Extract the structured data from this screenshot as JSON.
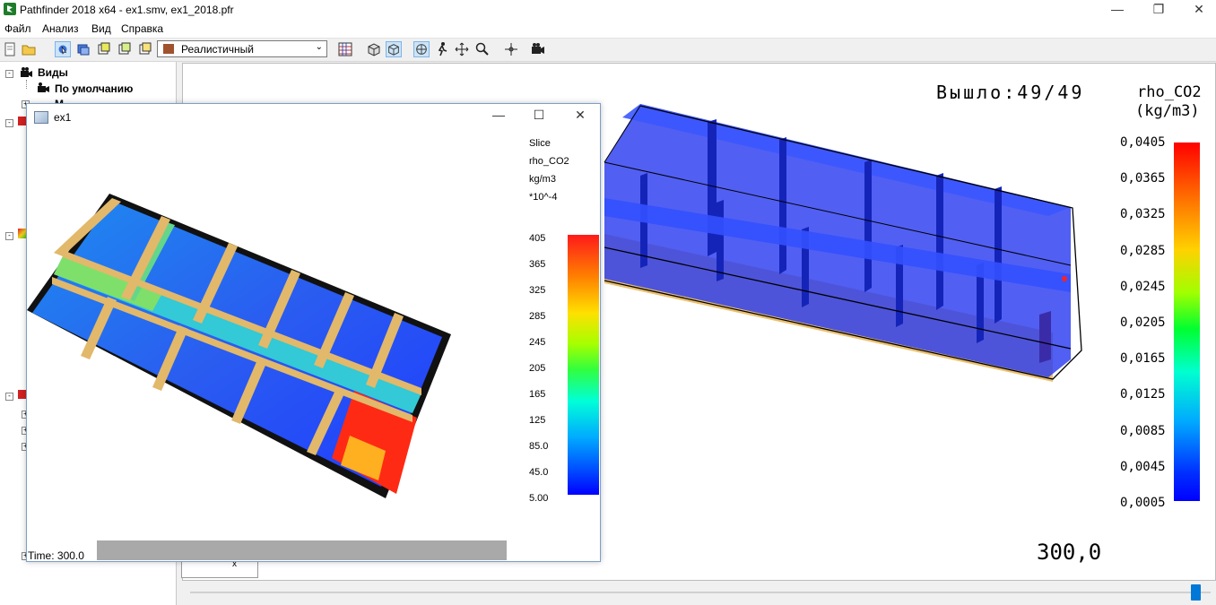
{
  "window": {
    "title": "Pathfinder 2018 x64 - ex1.smv, ex1_2018.pfr"
  },
  "window_controls": {
    "minimize": "—",
    "maximize": "❐",
    "close": "✕"
  },
  "menu": {
    "items": [
      "Файл",
      "Анализ",
      "Вид",
      "Справка"
    ]
  },
  "toolbar": {
    "render_mode": "Реалистичный"
  },
  "tree": {
    "root_label": "Виды",
    "child_label": "По умолчанию",
    "partial_label": "М"
  },
  "viewport": {
    "exited_label": "Вышло:49/49",
    "colorbar_title_1": "rho_CO2",
    "colorbar_title_2": "(kg/m3)",
    "colorbar_ticks": [
      "0,0405",
      "0,0365",
      "0,0325",
      "0,0285",
      "0,0245",
      "0,0205",
      "0,0165",
      "0,0125",
      "0,0085",
      "0,0045",
      "0,0005"
    ],
    "time_value": "300,0",
    "slider_position": 0.99
  },
  "ex1_window": {
    "title": "ex1",
    "controls": {
      "minimize": "—",
      "maximize": "☐",
      "close": "✕"
    },
    "labels": [
      "Slice",
      "rho_CO2",
      "kg/m3",
      "*10^-4"
    ],
    "colorbar_ticks": [
      "405",
      "365",
      "325",
      "285",
      "245",
      "205",
      "165",
      "125",
      "85.0",
      "45.0",
      "5.00"
    ],
    "time_label": "Time: 300.0"
  },
  "colors": {
    "accent": "#0078d7",
    "wall": "#e2b86a",
    "co2_high": "#ff2a00",
    "co2_low": "#1f3cff"
  }
}
